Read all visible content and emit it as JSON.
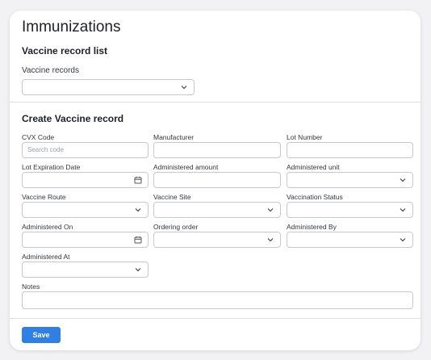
{
  "page_title": "Immunizations",
  "record_list": {
    "section_title": "Vaccine record list",
    "label": "Vaccine records",
    "value": ""
  },
  "create": {
    "section_title": "Create Vaccine record",
    "fields": {
      "cvx_code": {
        "label": "CVX Code",
        "placeholder": "Search code"
      },
      "manufacturer": {
        "label": "Manufacturer"
      },
      "lot_number": {
        "label": "Lot Number"
      },
      "lot_expiration_date": {
        "label": "Lot Expiration Date"
      },
      "administered_amount": {
        "label": "Administered amount"
      },
      "administered_unit": {
        "label": "Administered unit"
      },
      "vaccine_route": {
        "label": "Vaccine Route"
      },
      "vaccine_site": {
        "label": "Vaccine Site"
      },
      "vaccination_status": {
        "label": "Vaccination Status"
      },
      "administered_on": {
        "label": "Administered On"
      },
      "ordering_order": {
        "label": "Ordering order"
      },
      "administered_by": {
        "label": "Administered By"
      },
      "administered_at": {
        "label": "Administered At"
      },
      "notes": {
        "label": "Notes"
      }
    }
  },
  "save_label": "Save",
  "colors": {
    "accent": "#2f7fe6",
    "border": "#c6c9ce",
    "background": "#f2f2f4"
  },
  "icons": {
    "select": "chevron-down-icon",
    "date": "calendar-icon"
  }
}
